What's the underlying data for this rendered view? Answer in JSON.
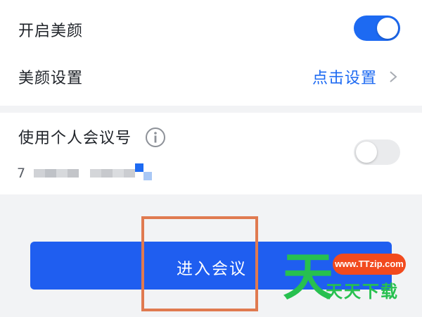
{
  "settings": {
    "beauty_toggle_label": "开启美颜",
    "beauty_toggle_state": "on",
    "beauty_settings_label": "美颜设置",
    "beauty_settings_link": "点击设置",
    "personal_meeting_id_label": "使用个人会议号",
    "personal_meeting_id_toggle_state": "off",
    "personal_meeting_id_value": "7"
  },
  "actions": {
    "enter_meeting_label": "进入会议"
  },
  "watermark": {
    "url": "www.TTzip.com",
    "site_name": "天天下载",
    "glyph": "天"
  },
  "colors": {
    "accent": "#1d6af2",
    "button": "#1f5ef0",
    "highlight_box": "#e07a50",
    "watermark_green": "#27c04f",
    "watermark_badge": "#f24a1e"
  },
  "icons": {
    "info": "info-icon",
    "chevron": "chevron-right-icon"
  }
}
